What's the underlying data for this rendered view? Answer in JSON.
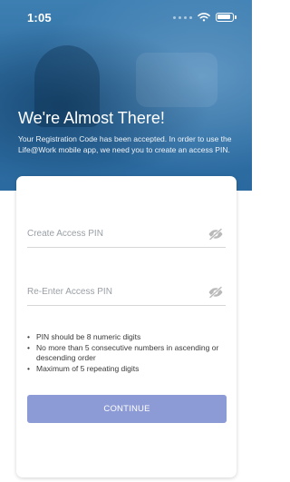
{
  "status_bar": {
    "time": "1:05",
    "icons": [
      "wifi-icon",
      "battery-icon"
    ]
  },
  "header": {
    "title": "We're Almost There!",
    "subtitle": "Your Registration Code has been accepted. In order to use the Life@Work mobile app, we need you to create an access PIN."
  },
  "form": {
    "create_pin_placeholder": "Create Access PIN",
    "reenter_pin_placeholder": "Re-Enter Access PIN",
    "rules": [
      "PIN should be 8 numeric digits",
      "No more than 5 consecutive numbers in ascending or descending order",
      "Maximum of 5 repeating digits"
    ],
    "continue_label": "CONTINUE"
  },
  "colors": {
    "hero_blue": "#2f6fa3",
    "button": "#8c9ad6",
    "text": "#3b3b3b",
    "placeholder": "#9aa0a6"
  }
}
